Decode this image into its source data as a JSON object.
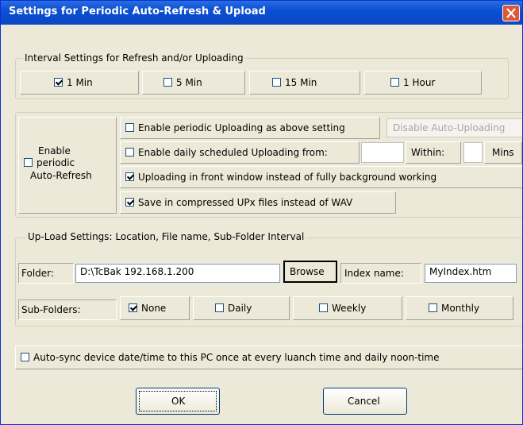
{
  "window": {
    "title": "Settings for Periodic Auto-Refresh & Upload"
  },
  "interval": {
    "legend": "Interval Settings for Refresh and/or Uploading",
    "options": [
      {
        "label": "1 Min",
        "checked": true
      },
      {
        "label": "5 Min",
        "checked": false
      },
      {
        "label": "15 Min",
        "checked": false
      },
      {
        "label": "1 Hour",
        "checked": false
      }
    ]
  },
  "refresh": {
    "enable_label_1": "Enable",
    "enable_label_2": "periodic",
    "enable_label_3": "Auto-Refresh",
    "enable_checked": false,
    "periodic_upload_label": "Enable periodic Uploading as above setting",
    "periodic_upload_checked": false,
    "disable_upload_button": "Disable Auto-Uploading",
    "daily_upload_label": "Enable daily scheduled Uploading from:",
    "daily_upload_checked": false,
    "daily_from_value": "",
    "within_label": "Within:",
    "within_value": "",
    "mins_label": "Mins",
    "front_window_label": "Uploading in front window instead of fully background working",
    "front_window_checked": true,
    "compressed_label": "Save in compressed UPx files instead of WAV",
    "compressed_checked": true
  },
  "upload": {
    "legend": "Up-Load Settings: Location, File name, Sub-Folder Interval",
    "folder_label": "Folder:",
    "folder_value": "D:\\TcBak  192.168.1.200",
    "browse_button": "Browse",
    "index_label": "Index name:",
    "index_value": "MyIndex.htm",
    "subfolders_label": "Sub-Folders:",
    "subfolder_options": [
      {
        "label": "None",
        "checked": true
      },
      {
        "label": "Daily",
        "checked": false
      },
      {
        "label": "Weekly",
        "checked": false
      },
      {
        "label": "Monthly",
        "checked": false
      }
    ]
  },
  "autosync": {
    "label": "Auto-sync device date/time to this PC once at every luanch time and daily noon-time",
    "checked": false
  },
  "buttons": {
    "ok": "OK",
    "cancel": "Cancel"
  },
  "colors": {
    "titlebar": "#0b4fd4",
    "dialog_bg": "#ece9d8",
    "close_button": "#e0563a"
  }
}
